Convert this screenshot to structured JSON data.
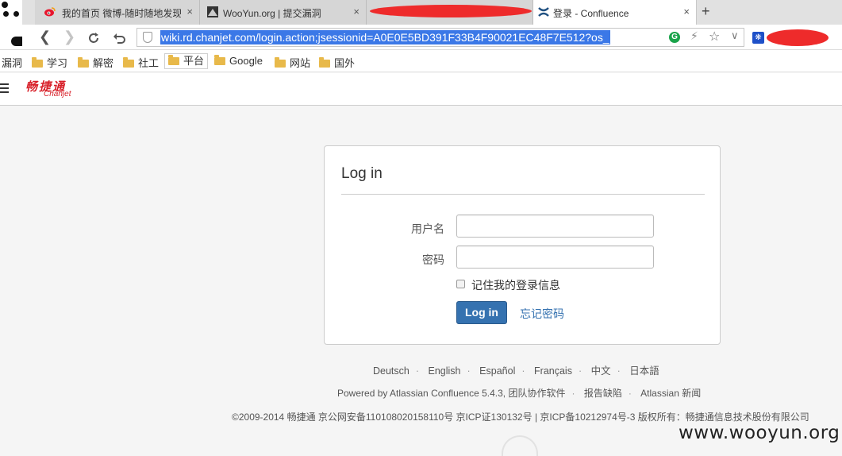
{
  "browser": {
    "tabs": [
      {
        "label": "我的首页 微博-随时随地发现",
        "icon": "weibo-icon"
      },
      {
        "label": "WooYun.org | 提交漏洞",
        "icon": "wooyun-icon"
      },
      {
        "label": "",
        "icon": ""
      },
      {
        "label": "登录 - Confluence",
        "icon": "confluence-icon"
      }
    ],
    "new_tab": "+",
    "close_glyph": "×",
    "url": "wiki.rd.chanjet.com/login.action;jsessionid=A0E0E5BD391F33B4F90021EC48F7E512?os_",
    "bookmarks": [
      "漏洞",
      "学习",
      "解密",
      "社工",
      "平台",
      "Google",
      "网站",
      "国外"
    ],
    "extension_g": "G"
  },
  "header": {
    "logo_cn": "畅捷通",
    "logo_en": "Chanjet"
  },
  "login": {
    "title": "Log in",
    "username_label": "用户名",
    "password_label": "密码",
    "remember_label": "记住我的登录信息",
    "submit": "Log in",
    "forgot": "忘记密码"
  },
  "footer": {
    "languages": [
      "Deutsch",
      "English",
      "Español",
      "Français",
      "中文",
      "日本語"
    ],
    "powered_by": "Powered by Atlassian Confluence 5.4.3, 团队协作软件",
    "report_bug": "报告缺陷",
    "news": "Atlassian 新闻",
    "copyright": "©2009-2014 畅捷通 京公网安备110108020158110号 京ICP证130132号 | 京ICP备10212974号-3 版权所有：畅捷通信息技术股份有限公司"
  },
  "watermark": "www.wooyun.org",
  "colors": {
    "accent": "#3572b0",
    "brand": "#d8212a",
    "url_highlight": "#3b78e7",
    "redaction": "#ee2b2b"
  }
}
